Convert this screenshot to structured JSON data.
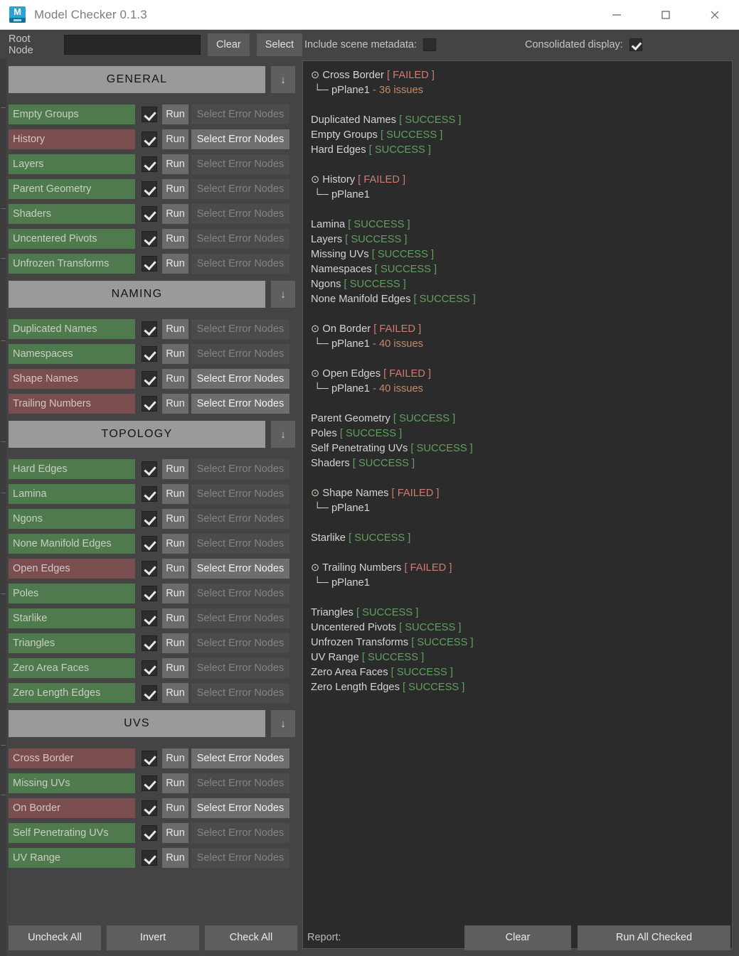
{
  "window": {
    "title": "Model Checker 0.1.3",
    "icon": "maya-app-icon",
    "minimize_label": "minimize-icon",
    "maximize_label": "maximize-icon",
    "close_label": "close-icon"
  },
  "toolbar": {
    "root_node_label": "Root Node",
    "root_node_value": "",
    "root_node_placeholder": "",
    "clear_label": "Clear",
    "select_label": "Select"
  },
  "options": {
    "include_metadata_label": "Include scene metadata:",
    "include_metadata_checked": false,
    "consolidated_label": "Consolidated display:",
    "consolidated_checked": true
  },
  "labels": {
    "run": "Run",
    "select_error_nodes": "Select Error Nodes",
    "collapse_arrow": "↓"
  },
  "sections": [
    {
      "title": "GENERAL",
      "checks": [
        {
          "name": "Empty Groups",
          "state": "pass",
          "checked": true,
          "errors": false
        },
        {
          "name": "History",
          "state": "fail",
          "checked": true,
          "errors": true
        },
        {
          "name": "Layers",
          "state": "pass",
          "checked": true,
          "errors": false
        },
        {
          "name": "Parent Geometry",
          "state": "pass",
          "checked": true,
          "errors": false
        },
        {
          "name": "Shaders",
          "state": "pass",
          "checked": true,
          "errors": false
        },
        {
          "name": "Uncentered Pivots",
          "state": "pass",
          "checked": true,
          "errors": false
        },
        {
          "name": "Unfrozen Transforms",
          "state": "pass",
          "checked": true,
          "errors": false
        }
      ]
    },
    {
      "title": "NAMING",
      "checks": [
        {
          "name": "Duplicated Names",
          "state": "pass",
          "checked": true,
          "errors": false
        },
        {
          "name": "Namespaces",
          "state": "pass",
          "checked": true,
          "errors": false
        },
        {
          "name": "Shape Names",
          "state": "fail",
          "checked": true,
          "errors": true
        },
        {
          "name": "Trailing Numbers",
          "state": "fail",
          "checked": true,
          "errors": true
        }
      ]
    },
    {
      "title": "TOPOLOGY",
      "checks": [
        {
          "name": "Hard Edges",
          "state": "pass",
          "checked": true,
          "errors": false
        },
        {
          "name": "Lamina",
          "state": "pass",
          "checked": true,
          "errors": false
        },
        {
          "name": "Ngons",
          "state": "pass",
          "checked": true,
          "errors": false
        },
        {
          "name": "None Manifold Edges",
          "state": "pass",
          "checked": true,
          "errors": false
        },
        {
          "name": "Open Edges",
          "state": "fail",
          "checked": true,
          "errors": true
        },
        {
          "name": "Poles",
          "state": "pass",
          "checked": true,
          "errors": false
        },
        {
          "name": "Starlike",
          "state": "pass",
          "checked": true,
          "errors": false
        },
        {
          "name": "Triangles",
          "state": "pass",
          "checked": true,
          "errors": false
        },
        {
          "name": "Zero Area Faces",
          "state": "pass",
          "checked": true,
          "errors": false
        },
        {
          "name": "Zero Length Edges",
          "state": "pass",
          "checked": true,
          "errors": false
        }
      ]
    },
    {
      "title": "UVS",
      "checks": [
        {
          "name": "Cross Border",
          "state": "fail",
          "checked": true,
          "errors": true
        },
        {
          "name": "Missing UVs",
          "state": "pass",
          "checked": true,
          "errors": false
        },
        {
          "name": "On Border",
          "state": "fail",
          "checked": true,
          "errors": true
        },
        {
          "name": "Self Penetrating UVs",
          "state": "pass",
          "checked": true,
          "errors": false
        },
        {
          "name": "UV Range",
          "state": "pass",
          "checked": true,
          "errors": false
        }
      ]
    }
  ],
  "report": {
    "bullet": "⊙",
    "branch": "└─",
    "status_fail": "[ FAILED ]",
    "status_pass": "[ SUCCESS ]",
    "lines": [
      {
        "kind": "fail",
        "name": "Cross Border"
      },
      {
        "kind": "node",
        "node": "pPlane1",
        "detail": "- 36 issues"
      },
      {
        "kind": "blank"
      },
      {
        "kind": "pass",
        "name": "Duplicated Names"
      },
      {
        "kind": "pass",
        "name": "Empty Groups"
      },
      {
        "kind": "pass",
        "name": "Hard Edges"
      },
      {
        "kind": "blank"
      },
      {
        "kind": "fail",
        "name": "History"
      },
      {
        "kind": "node",
        "node": "pPlane1",
        "detail": ""
      },
      {
        "kind": "blank"
      },
      {
        "kind": "pass",
        "name": "Lamina"
      },
      {
        "kind": "pass",
        "name": "Layers"
      },
      {
        "kind": "pass",
        "name": "Missing UVs"
      },
      {
        "kind": "pass",
        "name": "Namespaces"
      },
      {
        "kind": "pass",
        "name": "Ngons"
      },
      {
        "kind": "pass",
        "name": "None Manifold Edges"
      },
      {
        "kind": "blank"
      },
      {
        "kind": "fail",
        "name": "On Border"
      },
      {
        "kind": "node",
        "node": "pPlane1",
        "detail": "- 40 issues"
      },
      {
        "kind": "blank"
      },
      {
        "kind": "fail",
        "name": "Open Edges"
      },
      {
        "kind": "node",
        "node": "pPlane1",
        "detail": "- 40 issues"
      },
      {
        "kind": "blank"
      },
      {
        "kind": "pass",
        "name": "Parent Geometry"
      },
      {
        "kind": "pass",
        "name": "Poles"
      },
      {
        "kind": "pass",
        "name": "Self Penetrating UVs"
      },
      {
        "kind": "pass",
        "name": "Shaders"
      },
      {
        "kind": "blank"
      },
      {
        "kind": "fail",
        "name": "Shape Names"
      },
      {
        "kind": "node",
        "node": "pPlane1",
        "detail": ""
      },
      {
        "kind": "blank"
      },
      {
        "kind": "pass",
        "name": "Starlike"
      },
      {
        "kind": "blank"
      },
      {
        "kind": "fail",
        "name": "Trailing Numbers"
      },
      {
        "kind": "node",
        "node": "pPlane1",
        "detail": ""
      },
      {
        "kind": "blank"
      },
      {
        "kind": "pass",
        "name": "Triangles"
      },
      {
        "kind": "pass",
        "name": "Uncentered Pivots"
      },
      {
        "kind": "pass",
        "name": "Unfrozen Transforms"
      },
      {
        "kind": "pass",
        "name": "UV Range"
      },
      {
        "kind": "pass",
        "name": "Zero Area Faces"
      },
      {
        "kind": "pass",
        "name": "Zero Length Edges"
      }
    ]
  },
  "bottom": {
    "uncheck_all": "Uncheck All",
    "invert": "Invert",
    "check_all": "Check All",
    "report_label": "Report:",
    "clear": "Clear",
    "run_all_checked": "Run All Checked"
  },
  "colors": {
    "pass_row": "#4e7a4e",
    "fail_row": "#7a4e4e",
    "pass_text": "#5fa05f",
    "fail_text": "#cf7a72",
    "issues_text": "#c08a6a",
    "panel_bg": "#2b2b2b",
    "window_bg": "#444444",
    "section_header": "#9a9a9a"
  }
}
